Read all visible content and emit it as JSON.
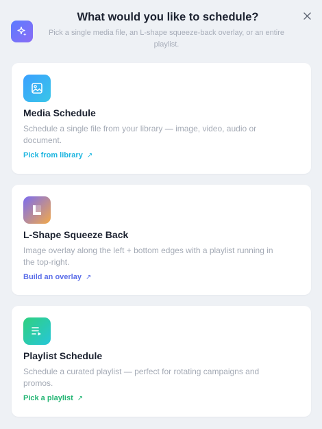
{
  "dialog": {
    "title": "What would you like to schedule?",
    "subtitle": "Pick a single media file, an L-shape squeeze-back overlay, or an entire playlist.",
    "header_icon": "sparkles-icon",
    "close_icon": "close-icon"
  },
  "options": [
    {
      "title": "Media Schedule",
      "description": "Schedule a single file from your library — image, video, audio or document.",
      "link_label": "Pick from library",
      "link_icon": "arrow-up-right-icon",
      "icon": "image-icon",
      "accent": "#1fb6e0",
      "icon_gradient": [
        "#3aa0ff",
        "#39c6e8"
      ]
    },
    {
      "title": "L-Shape Squeeze Back",
      "description": "Image overlay along the left + bottom edges with a playlist running in the top-right.",
      "link_label": "Build an overlay",
      "link_icon": "arrow-up-right-icon",
      "icon": "l-shape-icon",
      "accent": "#5b6ee8",
      "icon_gradient": [
        "#7b6cf0",
        "#f2a94a"
      ]
    },
    {
      "title": "Playlist Schedule",
      "description": "Schedule a curated playlist — perfect for rotating campaigns and promos.",
      "link_label": "Pick a playlist",
      "link_icon": "arrow-up-right-icon",
      "icon": "playlist-icon",
      "accent": "#22b573",
      "icon_gradient": [
        "#2fd07f",
        "#27c6d8"
      ]
    }
  ]
}
